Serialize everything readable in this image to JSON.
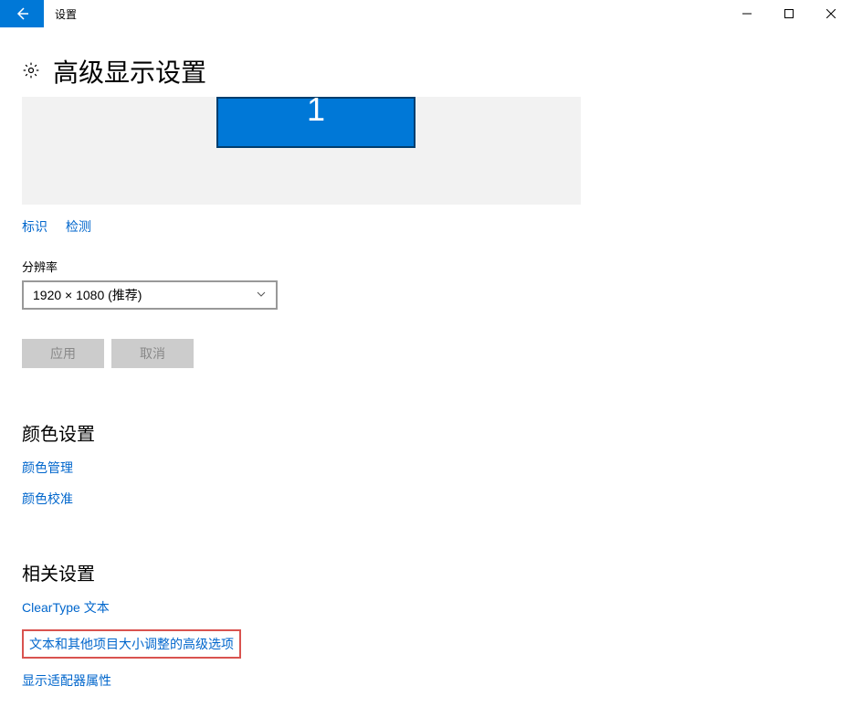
{
  "window": {
    "title": "设置"
  },
  "page": {
    "heading": "高级显示设置"
  },
  "monitor": {
    "label": "1"
  },
  "actions": {
    "identify": "标识",
    "detect": "检测"
  },
  "resolution": {
    "label": "分辨率",
    "selected": "1920 × 1080 (推荐)"
  },
  "buttons": {
    "apply": "应用",
    "cancel": "取消"
  },
  "color_section": {
    "heading": "颜色设置",
    "color_management": "颜色管理",
    "color_calibration": "颜色校准"
  },
  "related_section": {
    "heading": "相关设置",
    "cleartype": "ClearType 文本",
    "advanced_sizing": "文本和其他项目大小调整的高级选项",
    "adapter_props": "显示适配器属性"
  }
}
